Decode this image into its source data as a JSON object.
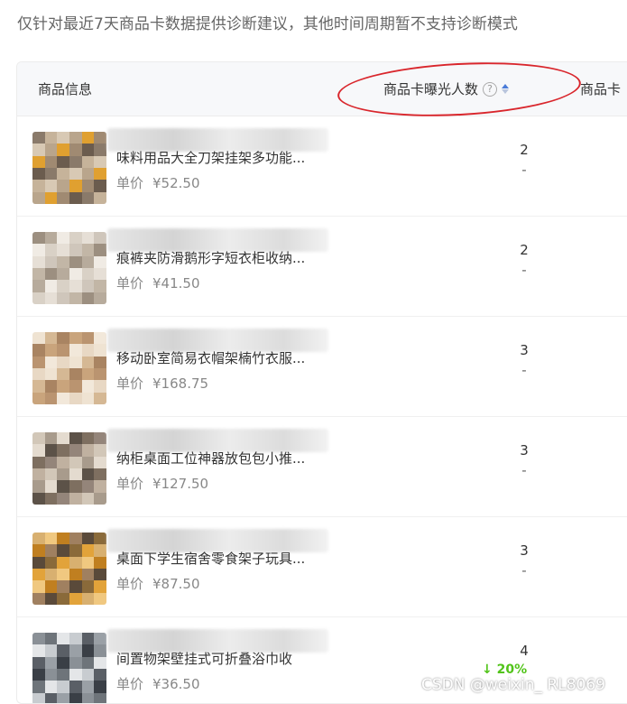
{
  "notice": "仅针对最近7天商品卡数据提供诊断建议，其他时间周期暂不支持诊断模式",
  "table": {
    "headers": {
      "product_info": "商品信息",
      "exposure": "商品卡曝光人数",
      "next_column_partial": "商品卡"
    },
    "help_icon": "question-circle-icon",
    "sort_icon": "sort-caret-icon",
    "price_label": "单价",
    "rows": [
      {
        "name": "味料用品大全刀架挂架多功能...",
        "price": "¥52.50",
        "exposure": "2",
        "change": "-"
      },
      {
        "name": "痕裤夹防滑鹅形字短衣柜收纳...",
        "price": "¥41.50",
        "exposure": "2",
        "change": "-"
      },
      {
        "name": "移动卧室简易衣帽架楠竹衣服...",
        "price": "¥168.75",
        "exposure": "3",
        "change": "-"
      },
      {
        "name": "纳柜桌面工位神器放包包小推...",
        "price": "¥127.50",
        "exposure": "3",
        "change": "-"
      },
      {
        "name": "桌面下学生宿舍零食架子玩具...",
        "price": "¥87.50",
        "exposure": "3",
        "change": "-"
      },
      {
        "name": "间置物架壁挂式可折叠浴巾收",
        "price": "¥36.50",
        "exposure": "4",
        "change": "↓ 20%"
      }
    ]
  },
  "colors": {
    "sort_active": "#4a7bd8",
    "annotation_circle": "#d9262c",
    "change_down": "#52c41a"
  },
  "watermark": "CSDN @weixin_ RL8069"
}
